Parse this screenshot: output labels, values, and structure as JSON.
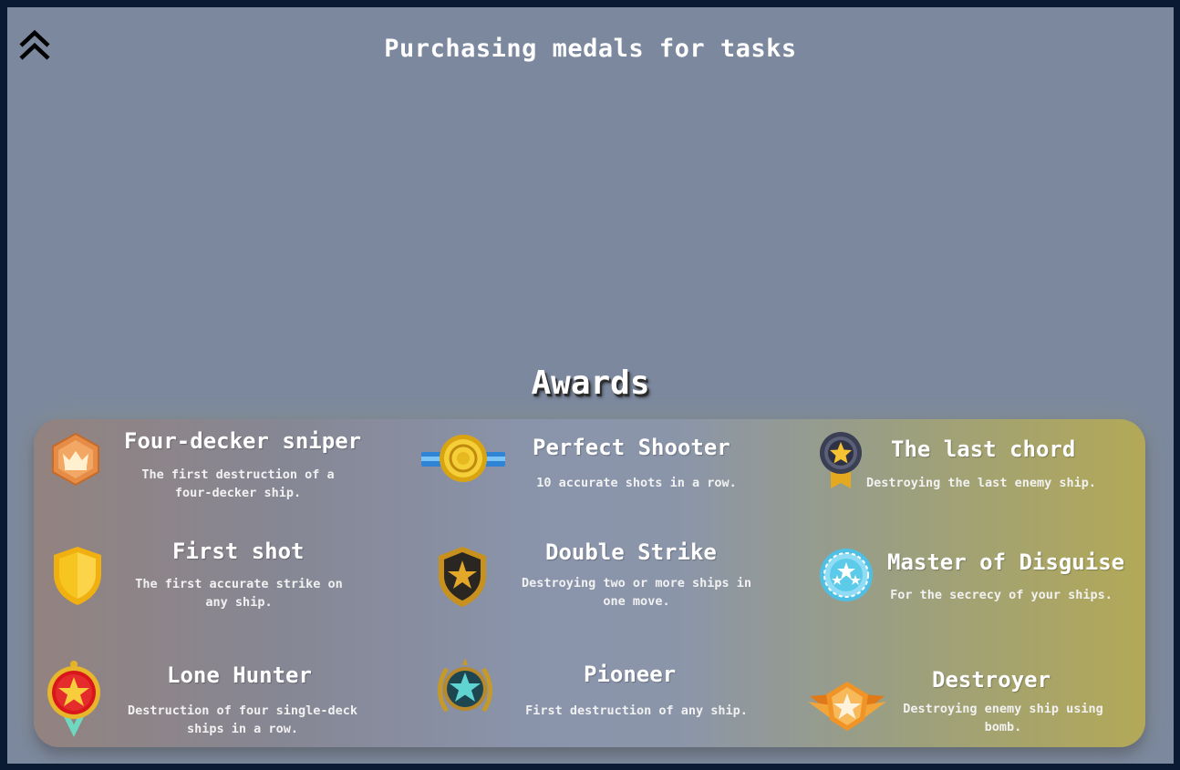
{
  "header": {
    "title": "Purchasing medals for tasks",
    "collapse_icon": "double-chevron-up-icon"
  },
  "awards": {
    "title": "Awards",
    "items": [
      {
        "name": "Four-decker sniper",
        "description": "The first destruction of a four-decker ship.",
        "icon": "crown-hexagon-icon",
        "color": "#e8944f"
      },
      {
        "name": "Perfect Shooter",
        "description": "10 accurate shots in a row.",
        "icon": "gold-coin-ribbon-icon",
        "color": "#e8b820"
      },
      {
        "name": "The last chord",
        "description": "Destroying the last enemy ship.",
        "icon": "star-medal-icon",
        "color": "#4a4e63"
      },
      {
        "name": "First shot",
        "description": "The first accurate strike on any ship.",
        "icon": "shield-icon",
        "color": "#f5c21b"
      },
      {
        "name": "Double Strike",
        "description": "Destroying two or more ships in one move.",
        "icon": "star-shield-icon",
        "color": "#2b2b2b"
      },
      {
        "name": "Master of Disguise",
        "description": "For the secrecy of your ships.",
        "icon": "three-stars-badge-icon",
        "color": "#5ccbea"
      },
      {
        "name": "Lone Hunter",
        "description": "Destruction of four single-deck ships in a row.",
        "icon": "red-star-medal-icon",
        "color": "#d9161b"
      },
      {
        "name": "Pioneer",
        "description": "First destruction of any ship.",
        "icon": "laurel-star-icon",
        "color": "#1d4650"
      },
      {
        "name": "Destroyer",
        "description": "Destroying enemy ship using bomb.",
        "icon": "winged-star-icon",
        "color": "#f09428"
      }
    ]
  }
}
